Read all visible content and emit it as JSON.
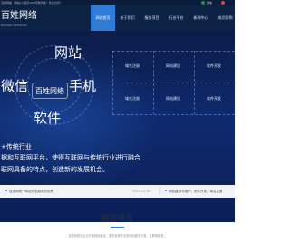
{
  "topbar": {
    "notice": "百姓网络（网站/小程序/APP定制开发）欢迎访问！",
    "wechat_label": "微信"
  },
  "header": {
    "logo": "百姓网络",
    "logo_sub": "BAIXING NETWORK",
    "nav": [
      "网站首页",
      "关于我们",
      "服务项目",
      "行业平台",
      "新闻中心",
      "成功案例"
    ]
  },
  "banner": {
    "bubbles": {
      "site": "网站",
      "wechat": "微信",
      "center": "百姓网络",
      "phone": "手机",
      "software": "软件"
    },
    "grid": [
      [
        "域名注册",
        "网站建设",
        "软件开发"
      ],
      [
        "域名注册",
        "网站建设",
        "软件开发"
      ]
    ],
    "slogan": [
      "+传统行业",
      "据和互联网平台，使得互联网与传统行业进行融合",
      "联网具备的特点，创造新的发展机会。"
    ]
  },
  "news": [
    {
      "text": "百姓网络一网站开发服务的优势",
      "date": "2015-12-09"
    },
    {
      "text": "网站建设与维护，软件开发，域名注册",
      "date": ""
    }
  ],
  "services": {
    "title": "服务项目",
    "desc": "百姓网络为企业打造网站建设、提供全面专业的网站解决方案，互联网服务。"
  },
  "colors": {
    "header_bg": "#0d2345",
    "nav_active": "#2f7bd8",
    "banner_bg": "#0e2a6e"
  }
}
